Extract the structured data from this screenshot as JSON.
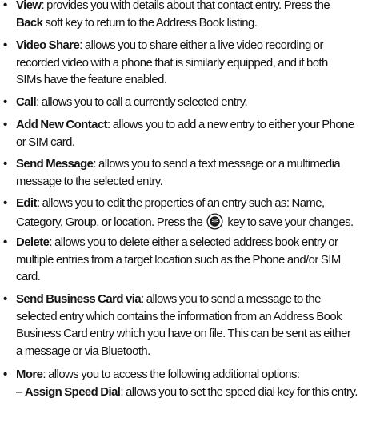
{
  "bullet_char": "•",
  "dash_char": "–",
  "items": [
    {
      "term": "View",
      "line1_rest": ": provides you with details about that contact entry. Press the",
      "line2_bold": "Back",
      "line2_rest": " soft key to return to the Address Book listing."
    },
    {
      "term": "Video Share",
      "line1_rest": ": allows you to share either a live video recording or",
      "line2": "recorded video with a phone that is similarly equipped, and if both",
      "line3": "SIMs have the feature enabled."
    },
    {
      "term": "Call",
      "line1_rest": ": allows you to call a currently selected entry."
    },
    {
      "term": "Add New Contact",
      "line1_rest": ": allows you to add a new entry to either your Phone",
      "line2": "or SIM card."
    },
    {
      "term": "Send Message",
      "line1_rest": ": allows you to send a text message or a multimedia",
      "line2": "message to the selected entry."
    },
    {
      "term": "Edit",
      "line1_rest": ": allows you to edit the properties of an entry such as: Name,",
      "line2_pre": "Category, Group, or location. Press the",
      "line2_icon": "center-select-key-icon",
      "line2_post": "key to save your changes."
    },
    {
      "term": "Delete",
      "line1_rest": ": allows you to delete either a selected address book entry or",
      "line2": "multiple entries from a target location such as the Phone and/or SIM",
      "line3": "card."
    },
    {
      "term": "Send Business Card via",
      "line1_rest": ": allows you to send a message to the",
      "line2": "selected entry which contains the information from an Address Book",
      "line3": "Business Card entry which you have on file. This can be sent as either",
      "line4": "a message or via Bluetooth."
    },
    {
      "term": "More",
      "line1_rest": ": allows you to access the following additional options:"
    }
  ],
  "sub_items": [
    {
      "term": "Assign Speed Dial",
      "rest": ": allows you to set the speed dial key for this entry."
    }
  ]
}
